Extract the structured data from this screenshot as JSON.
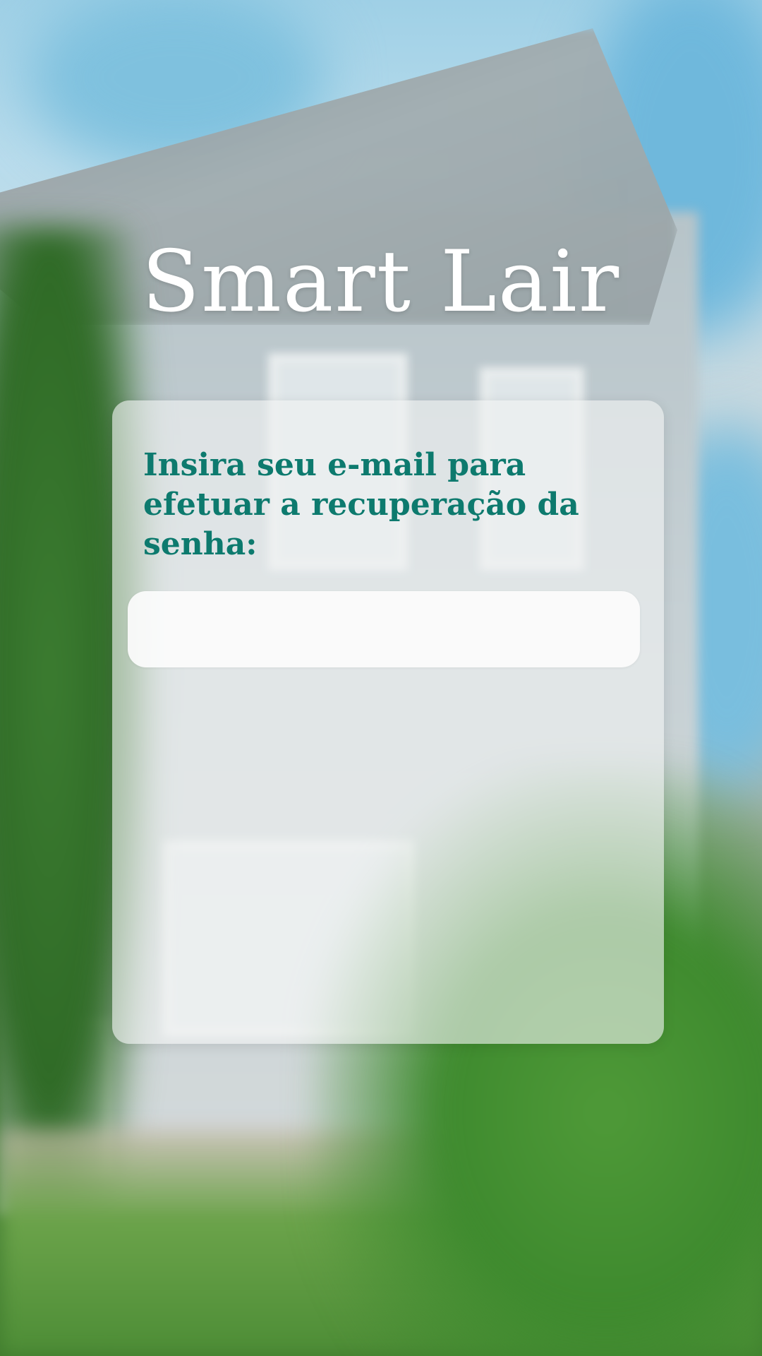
{
  "app": {
    "title": "Smart Lair"
  },
  "recovery": {
    "prompt": "Insira seu e-mail para efetuar a recuperação da senha:",
    "email_value": "",
    "email_placeholder": ""
  },
  "colors": {
    "accent": "#0d7a6e",
    "title": "#ffffff",
    "card": "#f0f2f2"
  },
  "background": {
    "icon": "blurred-house-photo"
  }
}
